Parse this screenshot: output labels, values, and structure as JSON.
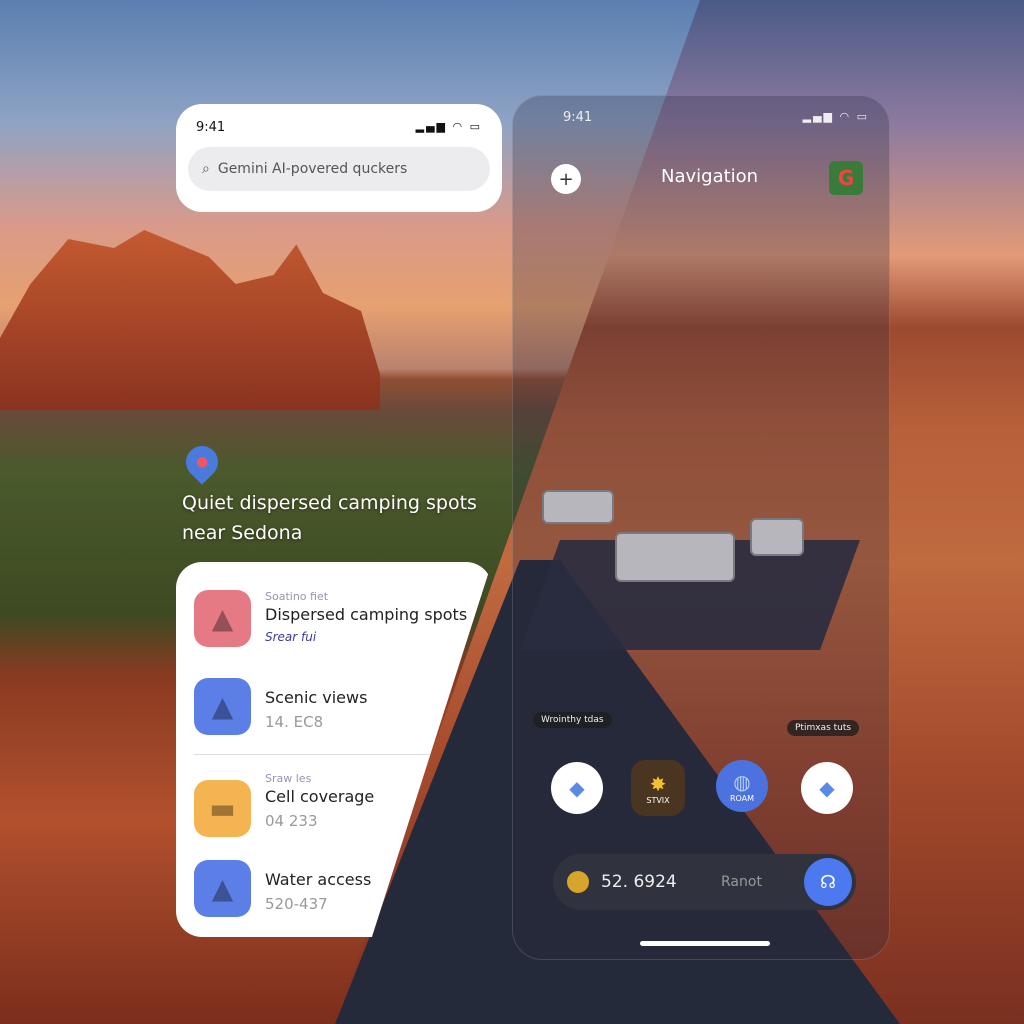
{
  "search_card": {
    "time": "9:41",
    "signal": "▂▄▆ ◠ ▭",
    "search_placeholder": "Gemini AI-povered quckers",
    "search_icon": "search-icon"
  },
  "location": {
    "pin_icon": "map-pin-icon",
    "title": "Quiet dispersed camping spots near Sedona"
  },
  "list": {
    "items": [
      {
        "section": "Soatino fiet",
        "title": "Dispersed camping spots",
        "link": "Srear fui",
        "icon": "tree-icon",
        "color": "#e57a85"
      },
      {
        "title": "Scenic views",
        "value": "14. EC8",
        "icon": "mountain-icon",
        "color": "#5b7fe6"
      },
      {
        "section": "Sraw les",
        "title": "Cell coverage",
        "value": "04 233",
        "icon": "rv-icon",
        "color": "#f5b452"
      },
      {
        "title": "Water access",
        "value": "520-437",
        "icon": "mountain-icon",
        "color": "#5b7fe6"
      }
    ]
  },
  "phone": {
    "time": "9:41",
    "signal": "▂▄▆ ◠ ▭",
    "title": "Navigation",
    "add_icon": "plus-icon",
    "logo": "G",
    "tags": [
      "Wrointhy tdas",
      "Ptimxas tuts"
    ],
    "fabs": [
      {
        "icon": "maps-icon",
        "label": ""
      },
      {
        "icon": "star-icon",
        "label": "STVIX"
      },
      {
        "icon": "globe-icon",
        "label": "ROAM"
      },
      {
        "icon": "maps-icon",
        "label": ""
      }
    ],
    "bottom": {
      "value": "52. 6924",
      "label": "Ranot",
      "action_icon": "navigate-icon"
    }
  }
}
